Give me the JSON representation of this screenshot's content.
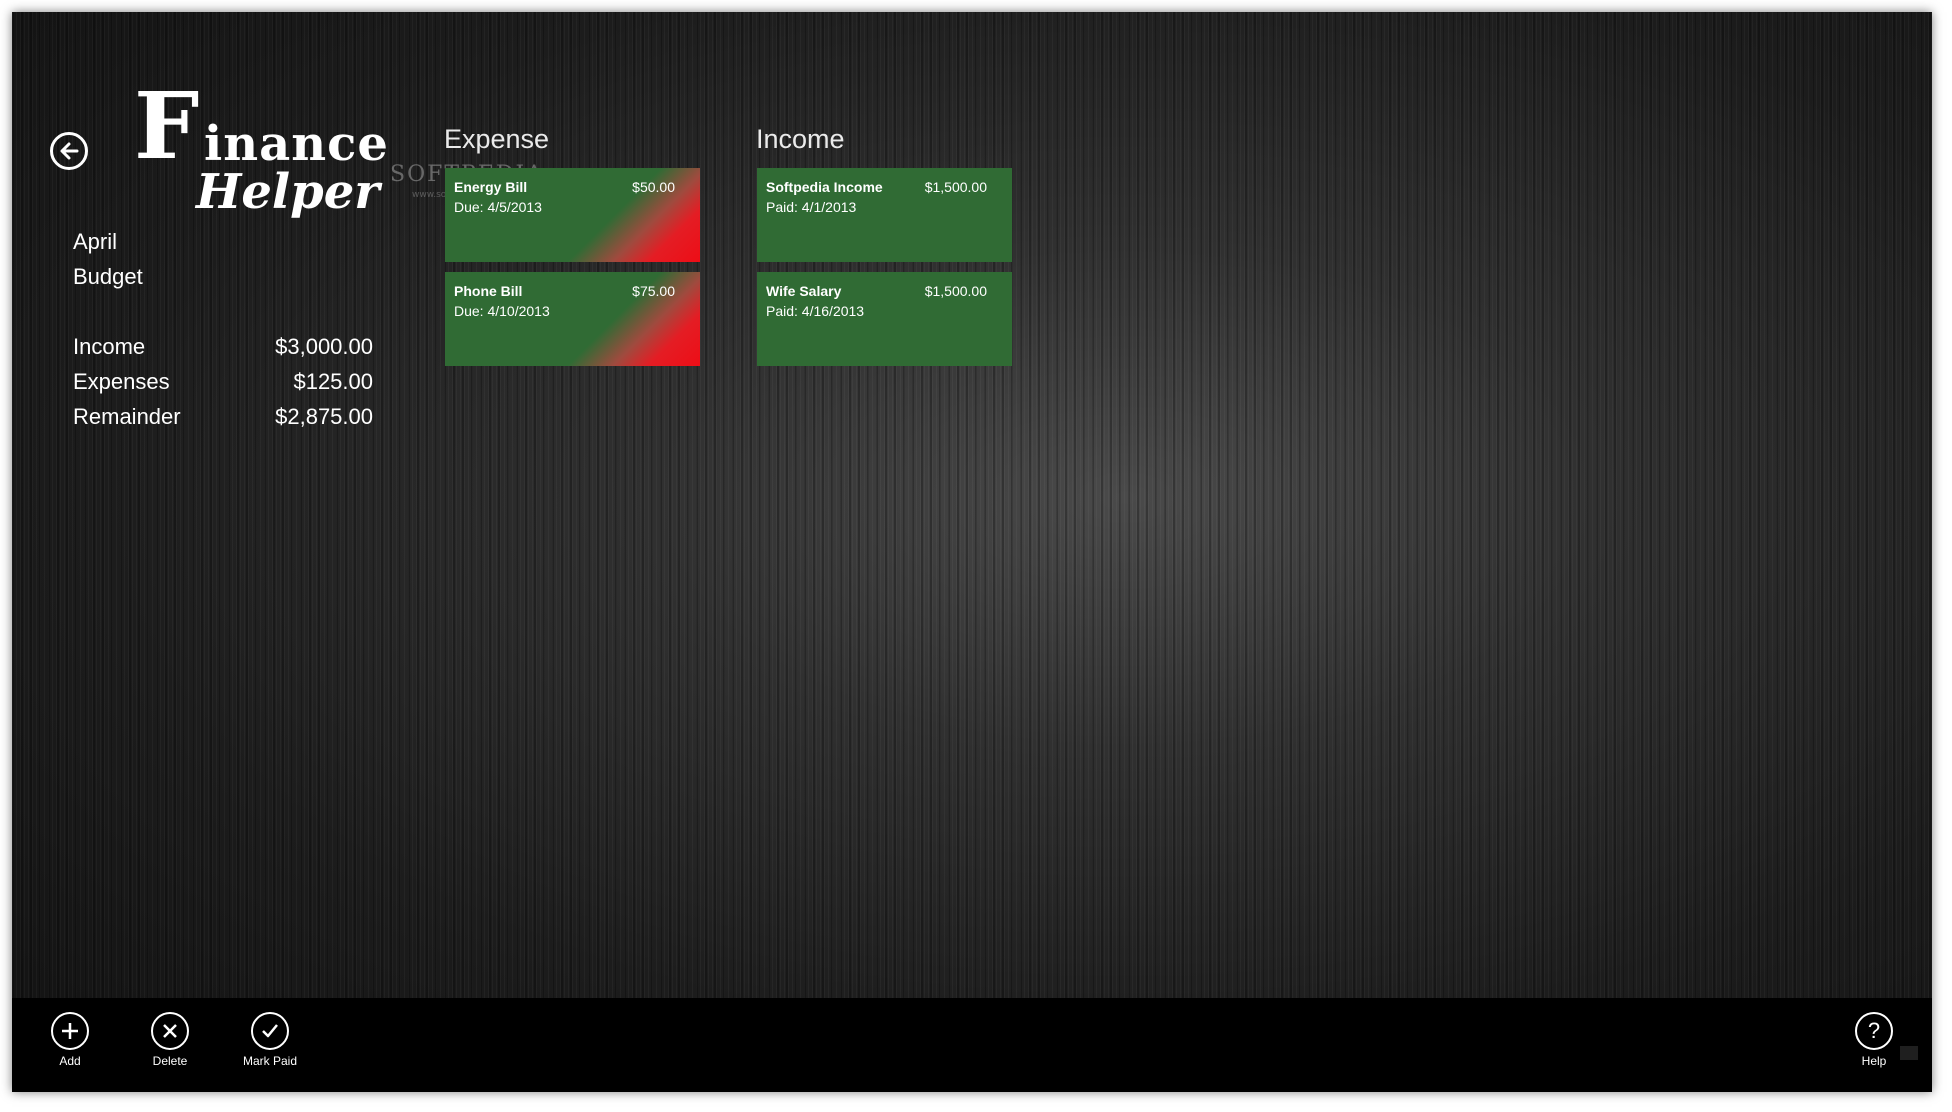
{
  "app": {
    "logo_big_letter": "F",
    "logo_word1": "inance",
    "logo_word2": "Helper",
    "watermark": "SOFTPEDIA",
    "watermark_sub": "www.softpedia.com"
  },
  "summary": {
    "month": "April",
    "subtitle": "Budget",
    "rows": [
      {
        "label": "Income",
        "value": "$3,000.00"
      },
      {
        "label": "Expenses",
        "value": "$125.00"
      },
      {
        "label": "Remainder",
        "value": "$2,875.00"
      }
    ]
  },
  "expense": {
    "title": "Expense",
    "items": [
      {
        "name": "Energy Bill",
        "amount": "$50.00",
        "detail": "Due: 4/5/2013"
      },
      {
        "name": "Phone Bill",
        "amount": "$75.00",
        "detail": "Due: 4/10/2013"
      }
    ]
  },
  "income": {
    "title": "Income",
    "items": [
      {
        "name": "Softpedia Income",
        "amount": "$1,500.00",
        "detail": "Paid: 4/1/2013"
      },
      {
        "name": "Wife Salary",
        "amount": "$1,500.00",
        "detail": "Paid: 4/16/2013"
      }
    ]
  },
  "app_bar": {
    "add": "Add",
    "delete": "Delete",
    "mark_paid": "Mark Paid",
    "help": "Help"
  },
  "colors": {
    "tile_green": "#306b34",
    "overdue_red": "#e41d24",
    "app_bar_bg": "#000000"
  },
  "icons": {
    "back": "back-arrow-icon",
    "add": "plus-icon",
    "delete": "x-icon",
    "mark_paid": "checkmark-icon",
    "help": "question-mark-icon"
  }
}
